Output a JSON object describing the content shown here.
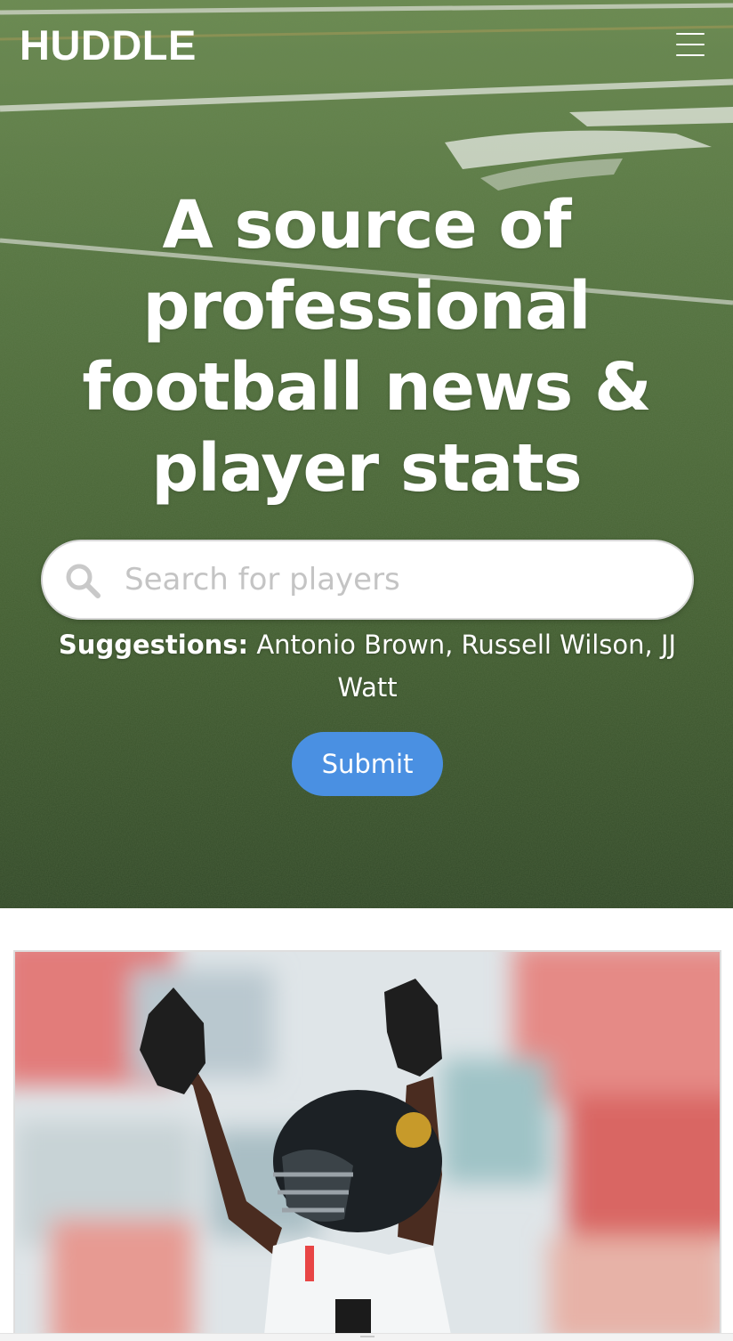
{
  "header": {
    "brand": "HUDDLE",
    "menu_icon": "hamburger-menu-icon"
  },
  "hero": {
    "headline": "A source of professional football news & player stats",
    "search": {
      "placeholder": "Search for players",
      "value": "",
      "icon": "search-icon"
    },
    "suggestions": {
      "label": "Suggestions:",
      "text": "Antonio Brown, Russell Wilson, JJ Watt"
    },
    "submit_label": "Submit"
  },
  "colors": {
    "accent": "#4a90e2",
    "text_on_hero": "#ffffff",
    "turf": "#4f6f3a",
    "jersey_teal": "#0b6e74"
  },
  "article": {
    "image": "player-celebration-photo"
  }
}
